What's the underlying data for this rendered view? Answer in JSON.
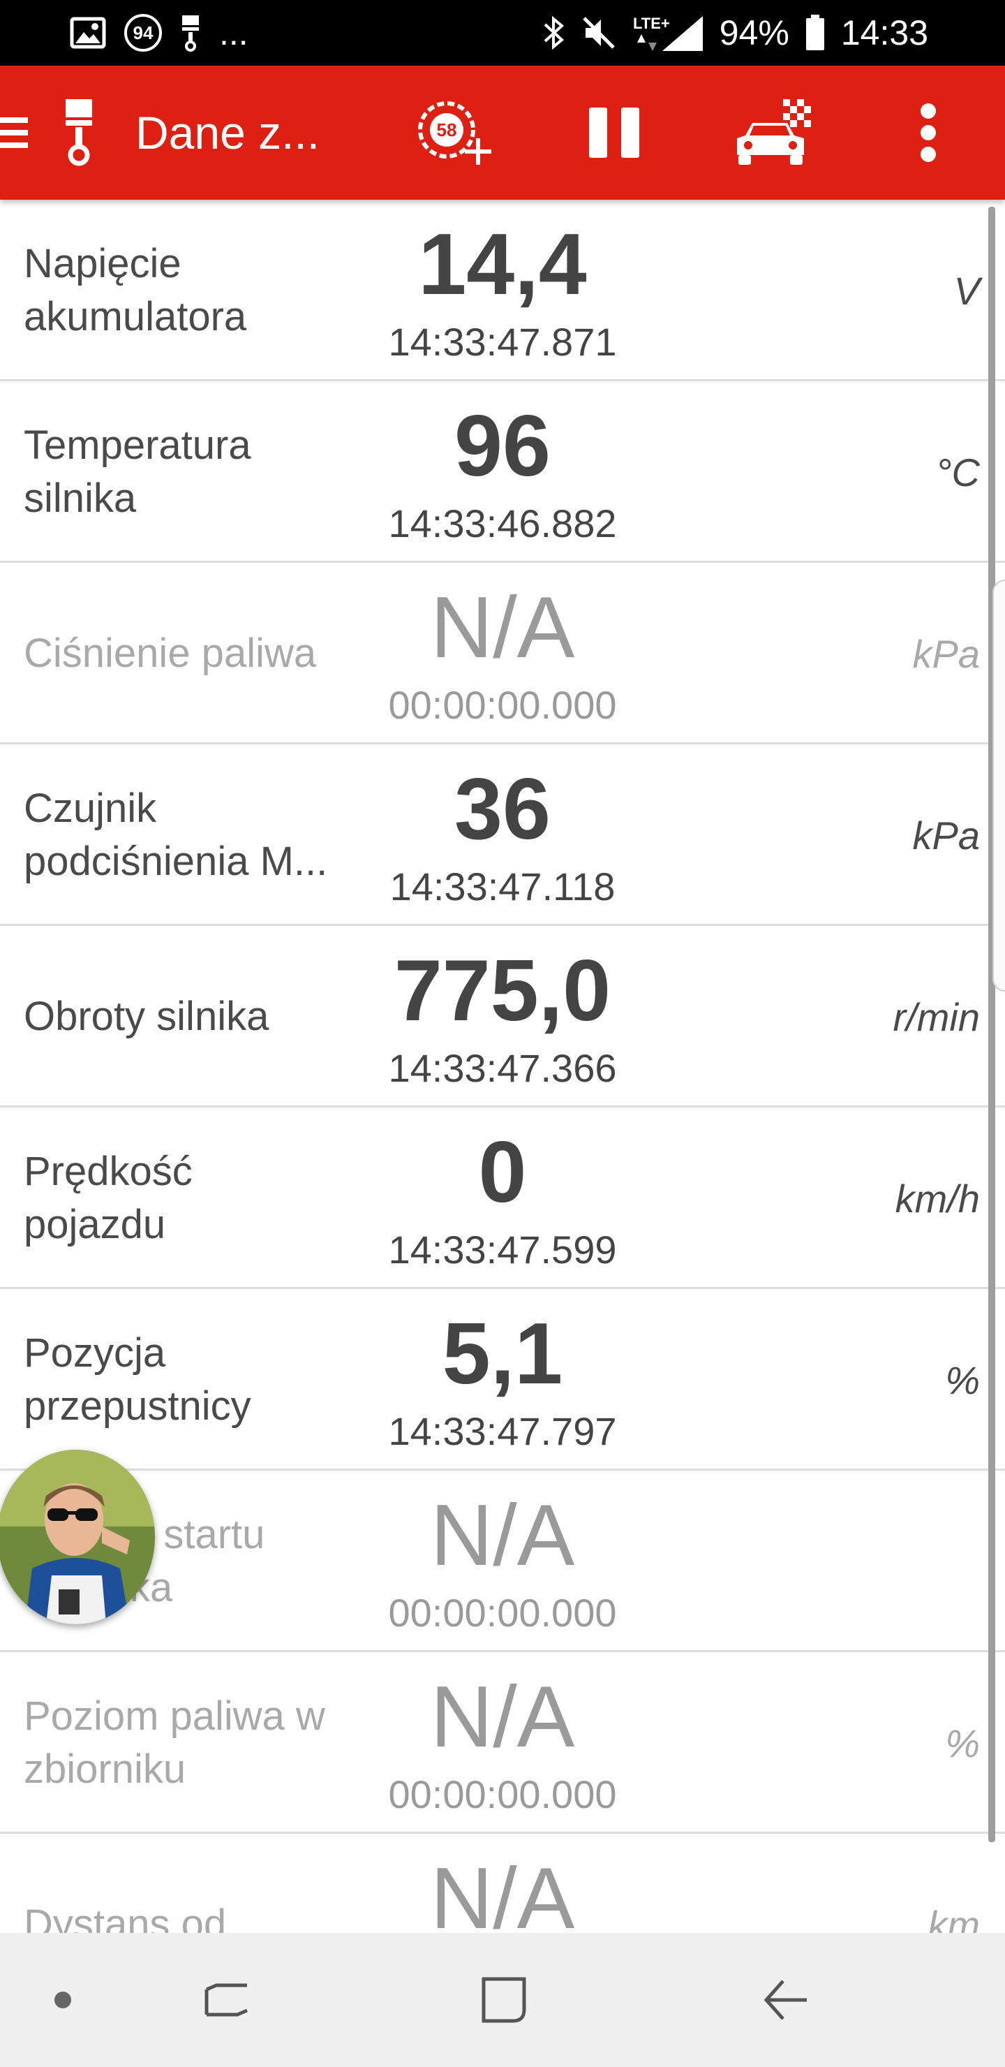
{
  "status_bar": {
    "left_icons": [
      "image-icon",
      "badge-94-icon",
      "piston-icon"
    ],
    "badge": "94",
    "more": "...",
    "right_icons": [
      "bluetooth-icon",
      "mute-icon",
      "lte-signal-icon",
      "battery-icon"
    ],
    "network": "LTE+",
    "battery": "94%",
    "time": "14:33"
  },
  "toolbar": {
    "title": "Dane z...",
    "speed_badge": "58",
    "bg_color": "#dd2012",
    "icons": [
      "menu-icon",
      "piston-icon",
      "speed-gauge-add-icon",
      "pause-icon",
      "race-car-flag-icon",
      "overflow-icon"
    ]
  },
  "rows": [
    {
      "label1": "Napięcie",
      "label2": "akumulatora",
      "value": "14,4",
      "time": "14:33:47.871",
      "unit": "V",
      "available": true
    },
    {
      "label1": "Temperatura",
      "label2": "silnika",
      "value": "96",
      "time": "14:33:46.882",
      "unit": "°C",
      "available": true
    },
    {
      "label1": "Ciśnienie paliwa",
      "label2": "",
      "value": "N/A",
      "time": "00:00:00.000",
      "unit": "kPa",
      "available": false
    },
    {
      "label1": "Czujnik",
      "label2": "podciśnienia M...",
      "value": "36",
      "time": "14:33:47.118",
      "unit": "kPa",
      "available": true
    },
    {
      "label1": "Obroty silnika",
      "label2": "",
      "value": "775,0",
      "time": "14:33:47.366",
      "unit": "r/min",
      "available": true
    },
    {
      "label1": "Prędkość",
      "label2": "pojazdu",
      "value": "0",
      "time": "14:33:47.599",
      "unit": "km/h",
      "available": true
    },
    {
      "label1": "Pozycja",
      "label2": "przepustnicy",
      "value": "5,1",
      "time": "14:33:47.797",
      "unit": "%",
      "available": true
    },
    {
      "label1": "d startu",
      "label2": "ka",
      "value": "N/A",
      "time": "00:00:00.000",
      "unit": "",
      "available": false
    },
    {
      "label1": "Poziom paliwa w",
      "label2": "zbiorniku",
      "value": "N/A",
      "time": "00:00:00.000",
      "unit": "%",
      "available": false
    },
    {
      "label1": "Dystans od",
      "label2": "",
      "value": "N/A",
      "time": "",
      "unit": "km",
      "available": false
    }
  ],
  "nav_bar": {
    "buttons": [
      "dot-icon",
      "recent-apps-icon",
      "home-icon",
      "back-icon"
    ]
  }
}
